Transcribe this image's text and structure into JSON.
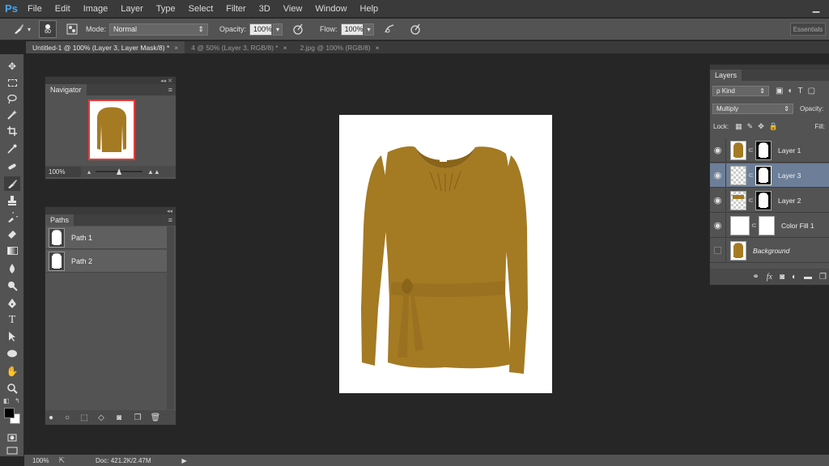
{
  "app": {
    "logo": "Ps"
  },
  "menu": [
    "File",
    "Edit",
    "Image",
    "Layer",
    "Type",
    "Select",
    "Filter",
    "3D",
    "View",
    "Window",
    "Help"
  ],
  "window_controls": {
    "minimize": "▁"
  },
  "options": {
    "brush_size": "60",
    "mode_label": "Mode:",
    "mode_value": "Normal",
    "opacity_label": "Opacity:",
    "opacity_value": "100%",
    "flow_label": "Flow:",
    "flow_value": "100%",
    "workspace": "Essentials"
  },
  "tabs": [
    {
      "label": "Untitled-1 @ 100% (Layer 3, Layer Mask/8) *",
      "close": "×"
    },
    {
      "label": "4 @ 50% (Layer 3, RGB/8) *",
      "close": "×"
    },
    {
      "label": "2.jpg @ 100% (RGB/8)",
      "close": "×"
    }
  ],
  "navigator": {
    "title": "Navigator",
    "zoom": "100%",
    "collapse": "◂◂  ✕"
  },
  "paths": {
    "title": "Paths",
    "collapse": "◂◂",
    "items": [
      {
        "name": "Path 1"
      },
      {
        "name": "Path 2"
      }
    ]
  },
  "layers": {
    "title": "Layers",
    "filter": "ρ Kind",
    "blend_mode": "Multiply",
    "opacity_label": "Opacity:",
    "lock_label": "Lock:",
    "fill_label": "Fill:",
    "items": [
      {
        "name": "Layer 1",
        "visible": true,
        "selected": false
      },
      {
        "name": "Layer 3",
        "visible": true,
        "selected": true
      },
      {
        "name": "Layer 2",
        "visible": true,
        "selected": false
      },
      {
        "name": "Color Fill 1",
        "visible": true,
        "selected": false
      },
      {
        "name": "Background",
        "visible": false,
        "selected": false
      }
    ]
  },
  "status": {
    "zoom": "100%",
    "doc": "Doc: 421.2K/2.47M"
  },
  "colors": {
    "garment": "#a47a23",
    "garment_dark": "#8a6418",
    "selection": "#6d7f98"
  }
}
